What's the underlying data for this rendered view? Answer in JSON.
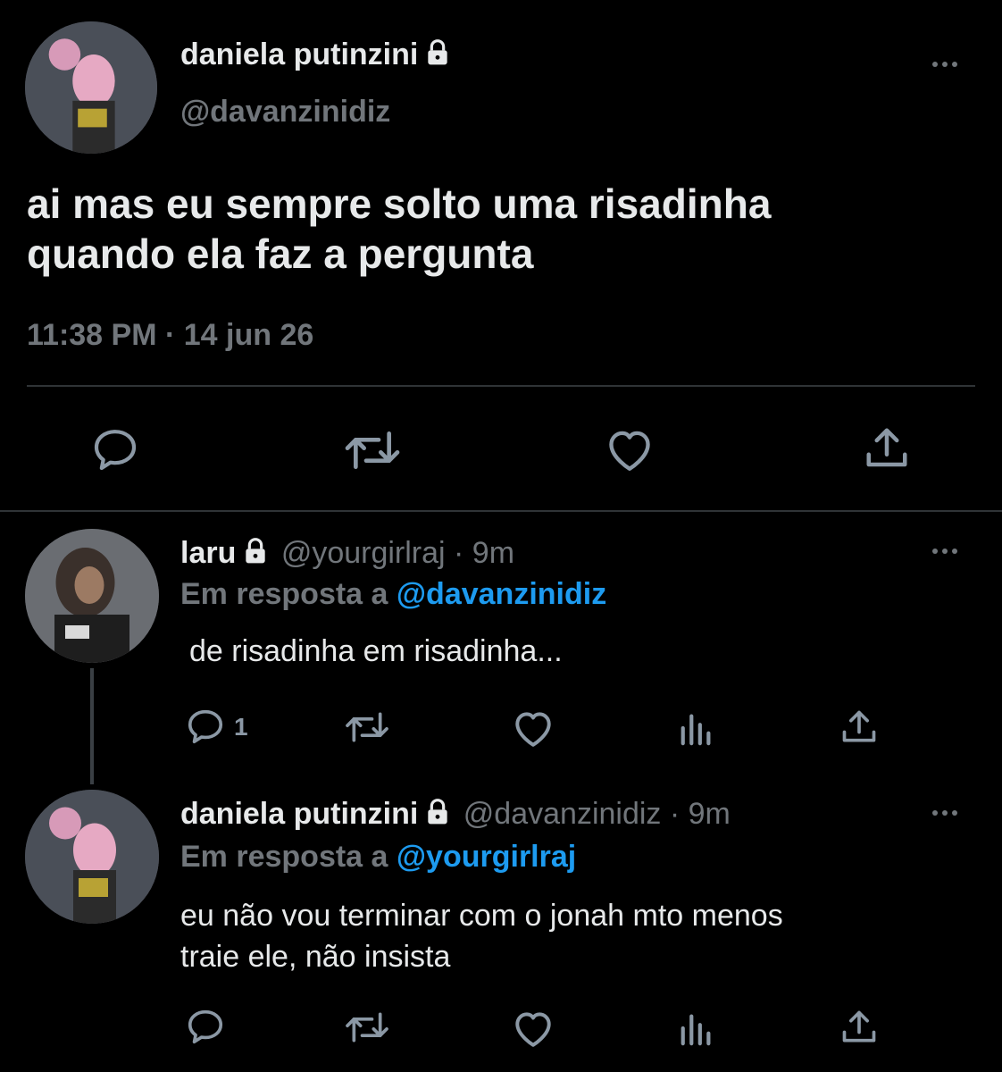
{
  "main_tweet": {
    "display_name": "daniela putinzini",
    "handle": "@davanzinidiz",
    "text_line1": "ai mas eu sempre solto uma risadinha",
    "text_line2": "quando ela faz a pergunta",
    "timestamp": "11:38 PM · 14 jun 26"
  },
  "replies": [
    {
      "display_name": "laru",
      "handle_time": "@yourgirlraj · 9m",
      "reply_prefix": "Em resposta a",
      "reply_to": "@davanzinidiz",
      "text": "de risadinha em risadinha...",
      "reply_count": "1"
    },
    {
      "display_name": "daniela putinzini",
      "handle_time": "@davanzinidiz · 9m",
      "reply_prefix": "Em resposta a",
      "reply_to": "@yourgirlraj",
      "text_line1": "eu não vou terminar com o jonah mto menos",
      "text_line2": "traie ele, não insista"
    }
  ],
  "icons": {
    "reply": "speech-bubble-icon",
    "retweet": "retweet-icon",
    "like": "heart-icon",
    "share": "share-icon",
    "views": "analytics-icon",
    "lock": "lock-icon",
    "more": "more-dots-icon"
  },
  "colors": {
    "background": "#000000",
    "text": "#e7e9ea",
    "secondary": "#71767b",
    "link": "#1d9bf0",
    "divider": "#2f3336"
  }
}
